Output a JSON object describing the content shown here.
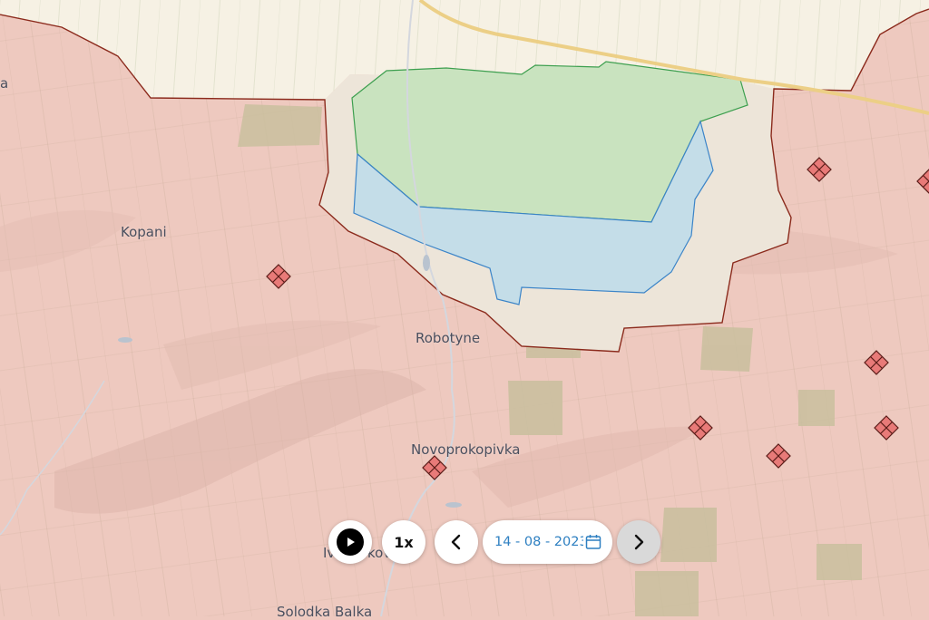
{
  "map": {
    "places": [
      {
        "key": "kopani",
        "label": "Kopani"
      },
      {
        "key": "robotyne",
        "label": "Robotyne"
      },
      {
        "key": "novoprokopivka",
        "label": "Novoprokopivka"
      },
      {
        "key": "ivanovka",
        "label": "Iva"
      },
      {
        "key": "ivanovka_suffix",
        "label": "kov"
      },
      {
        "key": "solodka",
        "label": "Solodka Balka"
      },
      {
        "key": "edge",
        "label": "a"
      }
    ],
    "colors": {
      "occupied_area": "#eec9bf",
      "contested_area": "#ede5d9",
      "liberated_green": "#c9e3bf",
      "liberated_blue": "#c4dde8",
      "front_line": "#8b2a1c",
      "green_border": "#3d9f4f",
      "blue_border": "#3b84c8",
      "free_area": "#f6f1e4",
      "marker_fill": "#e87a78"
    }
  },
  "timeline": {
    "play_icon": "play-icon",
    "speed": "1x",
    "prev_icon": "chevron-left-icon",
    "date": "14 - 08 - 2023",
    "calendar_icon": "calendar-icon",
    "next_icon": "chevron-right-icon"
  }
}
